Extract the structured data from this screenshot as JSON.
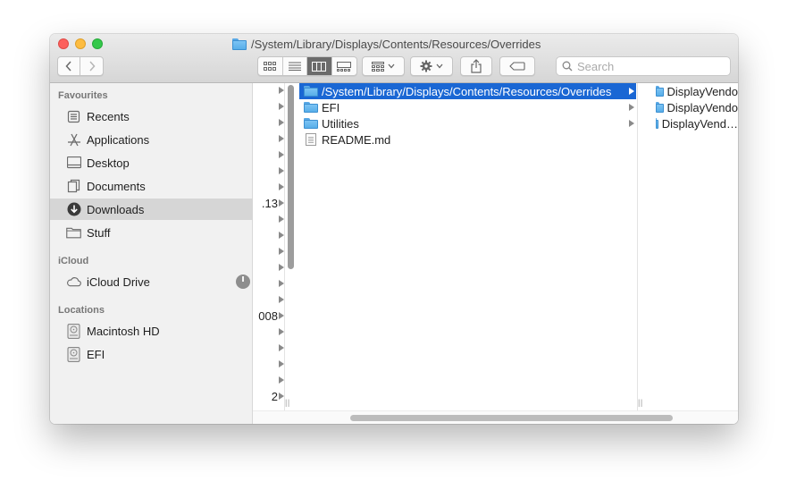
{
  "window": {
    "title": "/System/Library/Displays/Contents/Resources/Overrides"
  },
  "toolbar": {
    "back_icon": "chevron-left-icon",
    "forward_icon": "chevron-right-icon",
    "view_modes": [
      "icon-view",
      "list-view",
      "column-view",
      "gallery-view"
    ],
    "active_view": "column-view",
    "arrange_icon": "group-icon",
    "action_icon": "gear-icon",
    "share_icon": "share-icon",
    "tag_icon": "tag-icon",
    "search_placeholder": "Search"
  },
  "sidebar": {
    "sections": [
      {
        "header": "Favourites",
        "items": [
          {
            "label": "Recents",
            "icon": "recents-icon"
          },
          {
            "label": "Applications",
            "icon": "applications-icon"
          },
          {
            "label": "Desktop",
            "icon": "desktop-icon"
          },
          {
            "label": "Documents",
            "icon": "documents-icon"
          },
          {
            "label": "Downloads",
            "icon": "downloads-icon",
            "selected": true
          },
          {
            "label": "Stuff",
            "icon": "folder-icon"
          }
        ]
      },
      {
        "header": "iCloud",
        "items": [
          {
            "label": "iCloud Drive",
            "icon": "cloud-icon"
          }
        ]
      },
      {
        "header": "Locations",
        "items": [
          {
            "label": "Macintosh HD",
            "icon": "disk-icon"
          },
          {
            "label": "EFI",
            "icon": "disk-icon"
          }
        ]
      }
    ]
  },
  "column1": {
    "fragments": [
      ".13",
      "008",
      "2"
    ]
  },
  "column2": {
    "items": [
      {
        "name": "/System/Library/Displays/Contents/Resources/Overrides",
        "type": "folder",
        "selected": true,
        "has_children": true
      },
      {
        "name": "EFI",
        "type": "folder",
        "has_children": true
      },
      {
        "name": "Utilities",
        "type": "folder",
        "has_children": true
      },
      {
        "name": "README.md",
        "type": "file",
        "has_children": false
      }
    ]
  },
  "column3": {
    "items": [
      {
        "name": "DisplayVendo",
        "type": "folder"
      },
      {
        "name": "DisplayVendo",
        "type": "folder"
      },
      {
        "name": "DisplayVend…",
        "type": "folder"
      }
    ]
  },
  "colors": {
    "selection": "#1a67d4",
    "folder": "#6cb8ef",
    "sidebar_bg": "#f1f1f1",
    "sidebar_selected": "#d6d6d6"
  }
}
